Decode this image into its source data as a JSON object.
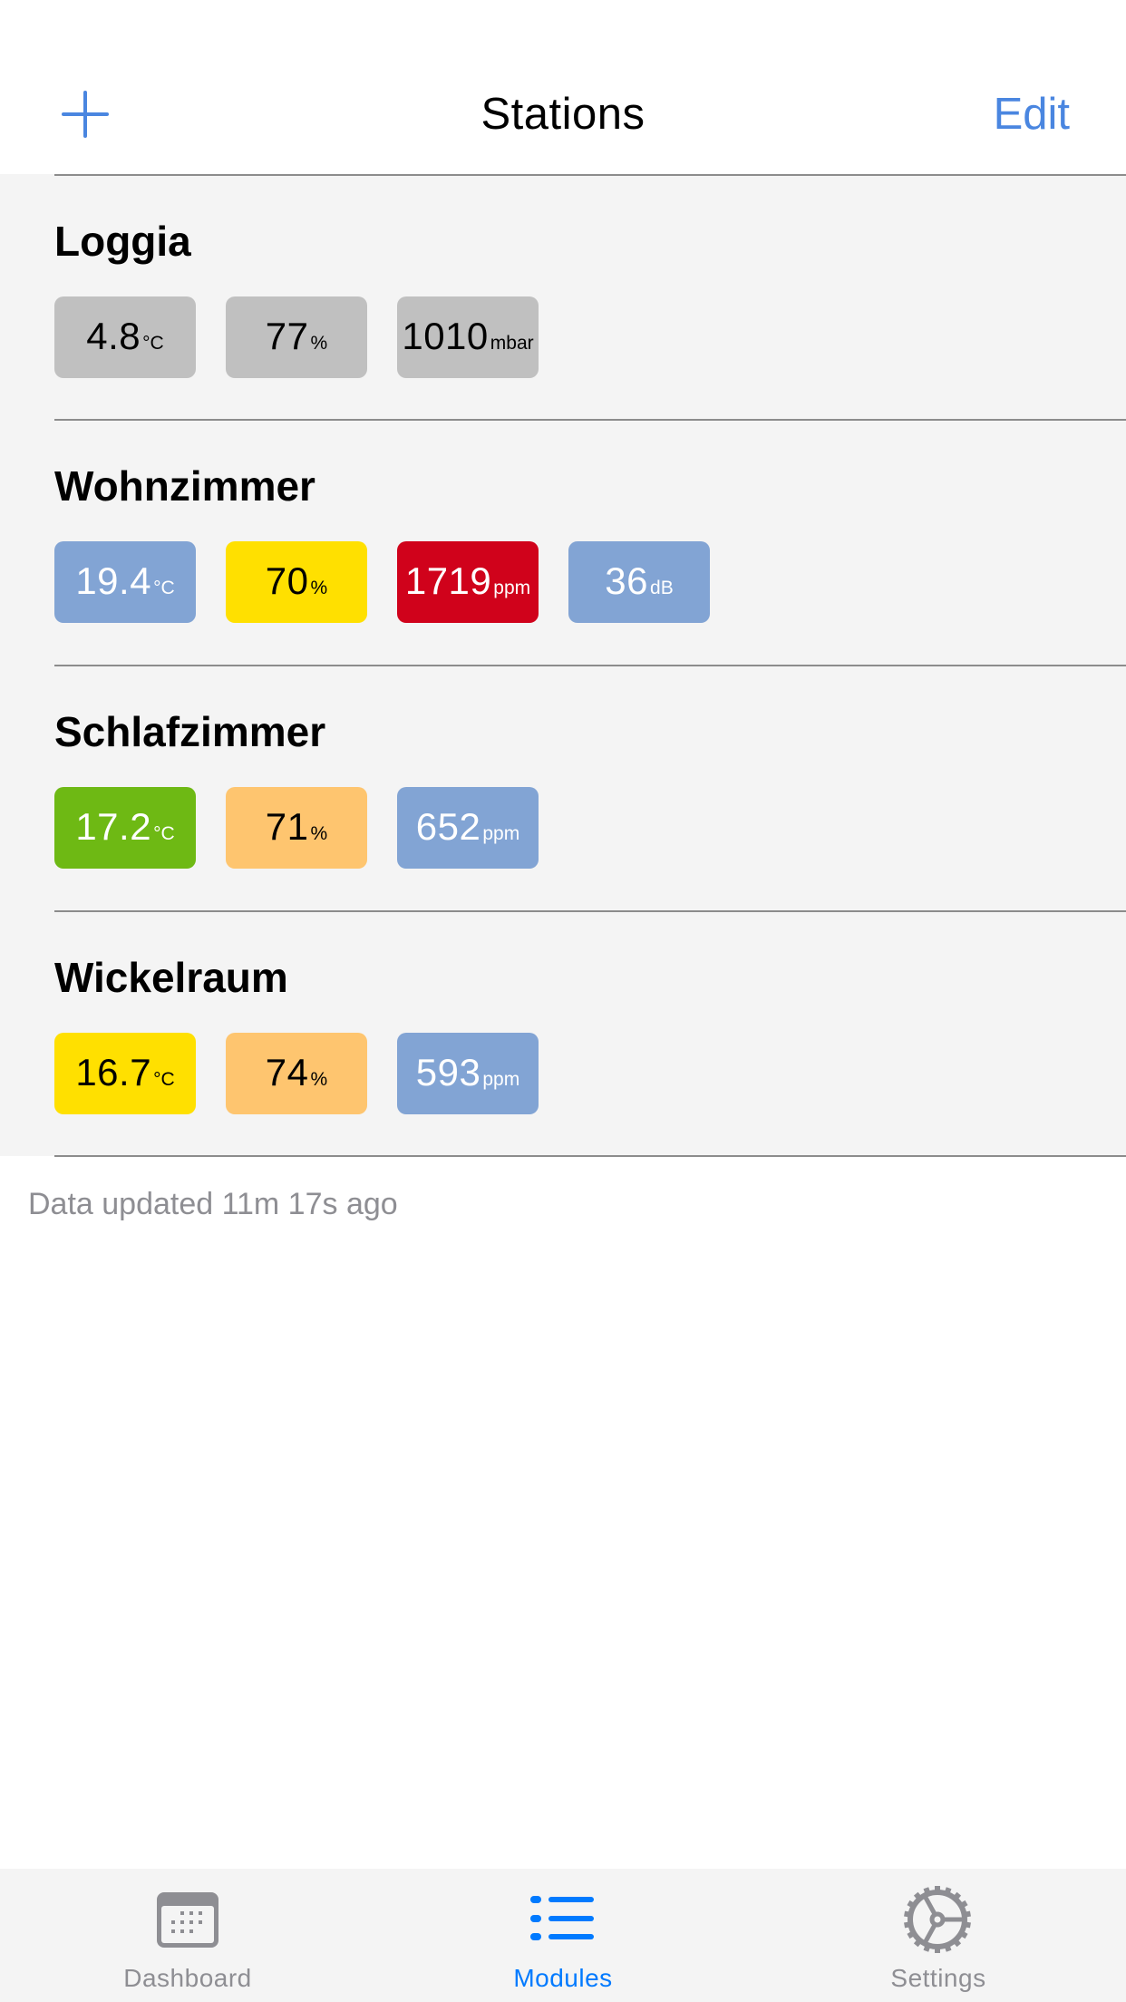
{
  "header": {
    "title": "Stations",
    "add_icon": "plus-icon",
    "edit_label": "Edit",
    "accent_color": "#4A86E0"
  },
  "stations": [
    {
      "name": "Loggia",
      "readings": [
        {
          "value": "4.8",
          "unit": "°C",
          "bg": "#C0C0C0",
          "fg": "#000000"
        },
        {
          "value": "77",
          "unit": "%",
          "bg": "#C0C0C0",
          "fg": "#000000"
        },
        {
          "value": "1010",
          "unit": "mbar",
          "bg": "#C0C0C0",
          "fg": "#000000"
        }
      ]
    },
    {
      "name": "Wohnzimmer",
      "readings": [
        {
          "value": "19.4",
          "unit": "°C",
          "bg": "#82A4D4",
          "fg": "#FFFFFF"
        },
        {
          "value": "70",
          "unit": "%",
          "bg": "#FFE000",
          "fg": "#000000"
        },
        {
          "value": "1719",
          "unit": "ppm",
          "bg": "#D0021B",
          "fg": "#FFFFFF"
        },
        {
          "value": "36",
          "unit": "dB",
          "bg": "#82A4D4",
          "fg": "#FFFFFF"
        }
      ]
    },
    {
      "name": "Schlafzimmer",
      "readings": [
        {
          "value": "17.2",
          "unit": "°C",
          "bg": "#6EB914",
          "fg": "#FFFFFF"
        },
        {
          "value": "71",
          "unit": "%",
          "bg": "#FEC56F",
          "fg": "#000000"
        },
        {
          "value": "652",
          "unit": "ppm",
          "bg": "#82A4D4",
          "fg": "#FFFFFF"
        }
      ]
    },
    {
      "name": "Wickelraum",
      "readings": [
        {
          "value": "16.7",
          "unit": "°C",
          "bg": "#FFE000",
          "fg": "#000000"
        },
        {
          "value": "74",
          "unit": "%",
          "bg": "#FEC56F",
          "fg": "#000000"
        },
        {
          "value": "593",
          "unit": "ppm",
          "bg": "#82A4D4",
          "fg": "#FFFFFF"
        }
      ]
    }
  ],
  "footer": {
    "status_text": "Data updated 11m 17s ago"
  },
  "tabbar": {
    "active_color": "#007AFF",
    "inactive_color": "#8E8E93",
    "tabs": [
      {
        "label": "Dashboard",
        "icon": "calendar-icon",
        "active": false
      },
      {
        "label": "Modules",
        "icon": "list-icon",
        "active": true
      },
      {
        "label": "Settings",
        "icon": "gear-icon",
        "active": false
      }
    ]
  }
}
